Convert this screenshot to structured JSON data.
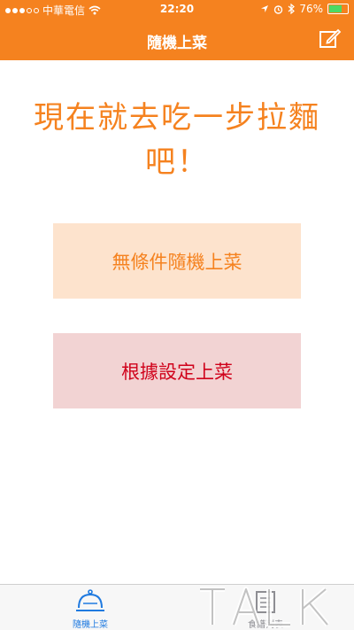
{
  "status_bar": {
    "carrier": "中華電信",
    "time": "22:20",
    "battery": "76%",
    "battery_level": 0.76
  },
  "nav": {
    "title": "隨機上菜",
    "edit_icon": "compose-icon"
  },
  "main": {
    "headline": "現在就去吃一步拉麵吧！",
    "random_button": "無條件隨機上菜",
    "settings_button": "根據設定上菜"
  },
  "tabbar": {
    "tabs": [
      {
        "label": "隨機上菜",
        "icon": "service-bell-icon",
        "selected": true
      },
      {
        "label": "食譜列表",
        "icon": "list-box-icon",
        "selected": false
      }
    ]
  },
  "watermark": "TALK",
  "colors": {
    "accent": "#f5821f",
    "random_button_bg": "#fde3cd",
    "settings_button_bg": "#f2d3d3",
    "settings_button_text": "#d0021b",
    "tab_selected": "#1f7ae0"
  }
}
